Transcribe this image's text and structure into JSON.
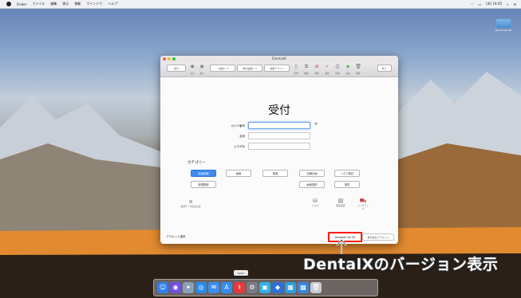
{
  "menubar": {
    "items": [
      "Finder",
      "ファイル",
      "編集",
      "表示",
      "移動",
      "ウインドウ",
      "ヘルプ"
    ],
    "clock": "(木) 14:45"
  },
  "desktop": {
    "hd_label": "Macintosh HD"
  },
  "window": {
    "title": "DentalX",
    "toolbar": {
      "left_button": "送付",
      "dropdown1": "一般案へ",
      "dropdown2": "受付画面へ",
      "dropdown3": "運動アプリ",
      "finish_button": "終了",
      "icons": [
        {
          "icon": "back-icon",
          "label": "戻る"
        },
        {
          "icon": "forward-icon",
          "label": "進む"
        },
        {
          "icon": "new-icon",
          "label": "新規"
        },
        {
          "icon": "duplicate-icon",
          "label": "複製"
        },
        {
          "icon": "delete-icon",
          "label": "削除"
        },
        {
          "icon": "check-icon",
          "label": "検索"
        },
        {
          "icon": "print-icon",
          "label": "印刷"
        },
        {
          "icon": "save-icon",
          "label": "設定"
        },
        {
          "icon": "trash-icon",
          "label": "削除"
        }
      ]
    },
    "main_title": "受付",
    "form": {
      "chart_number_label": "カルテ番号",
      "name_label": "名前",
      "furigana_label": "ふりがな",
      "chart_number_value": "",
      "name_value": "",
      "furigana_value": ""
    },
    "category": {
      "title": "カテゴリー",
      "row1": [
        "患者情報",
        "画像",
        "検査",
        "治療計画",
        "リスク検討"
      ],
      "row2": [
        "新規登録",
        "画像選択",
        "提供"
      ],
      "selected": "患者情報"
    },
    "import_label": "患者データ読み込み",
    "bottom_icons": [
      {
        "icon": "help-icon",
        "label": "ヘルプ"
      },
      {
        "icon": "settings-icon",
        "label": "環境設定"
      },
      {
        "icon": "backup-icon",
        "label": "バックアップ"
      }
    ],
    "clinic_label": "ブラキット歯科",
    "version": "DentalX v8.20",
    "company_button": "株式会社ブラキット"
  },
  "annotation": "DentalXのバージョン表示",
  "dock": {
    "tooltip": "Safari",
    "apps": [
      {
        "icon": "finder-icon",
        "color": "#2f7ff0"
      },
      {
        "icon": "siri-icon",
        "color": "#7050e0"
      },
      {
        "icon": "launchpad-icon",
        "color": "#8aa0b8"
      },
      {
        "icon": "safari-icon",
        "color": "#2a8ae8"
      },
      {
        "icon": "mail-icon",
        "color": "#3a90f0"
      },
      {
        "icon": "appstore-icon",
        "color": "#2f8df5"
      },
      {
        "icon": "dentalx-icon",
        "color": "#e23a3a"
      },
      {
        "icon": "preferences-icon",
        "color": "#7a7a80"
      },
      {
        "icon": "app1-icon",
        "color": "#2eb0e8"
      },
      {
        "icon": "app2-icon",
        "color": "#2f6fd8"
      },
      {
        "icon": "app3-icon",
        "color": "#2aa0e0"
      },
      {
        "icon": "app4-icon",
        "color": "#3b86d8"
      },
      {
        "icon": "trash-icon",
        "color": "#c8ccd2"
      }
    ]
  }
}
